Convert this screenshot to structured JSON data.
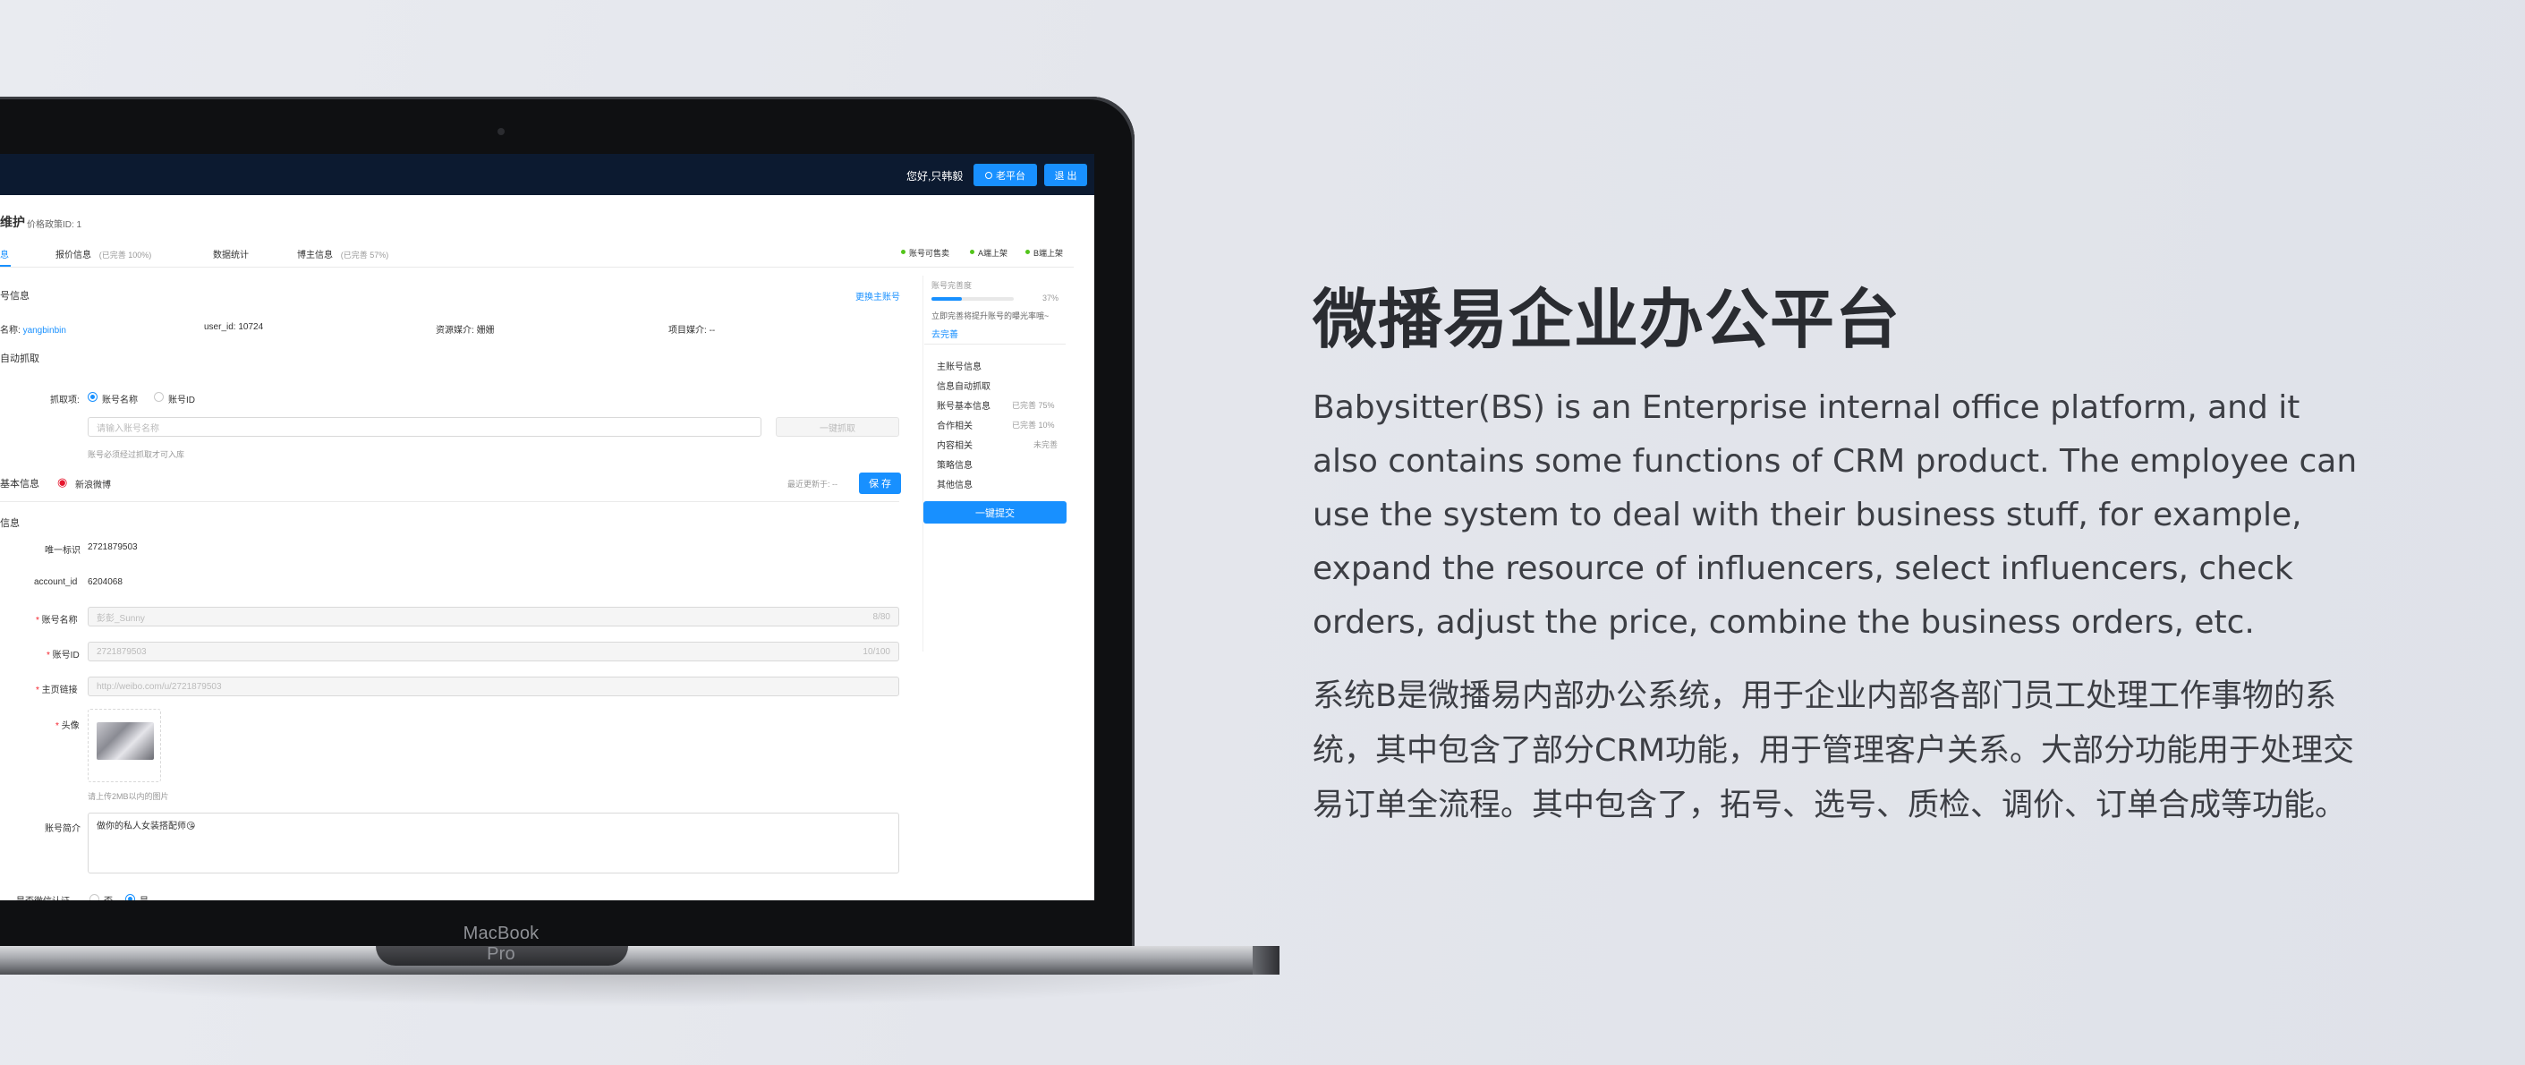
{
  "laptop": {
    "brand": "MacBook Pro"
  },
  "app": {
    "greeting": "您好,只韩毅",
    "old_platform_label": "老平台",
    "logout_label": "退 出",
    "page_title": "维护",
    "price_policy": "价格政策ID: 1",
    "tabs": [
      {
        "label": "息",
        "note": ""
      },
      {
        "label": "报价信息",
        "note": "(已完善 100%)"
      },
      {
        "label": "数据统计",
        "note": ""
      },
      {
        "label": "博主信息",
        "note": "(已完善 57%)"
      }
    ],
    "status_tags": [
      "账号可售卖",
      "A端上架",
      "B端上架"
    ],
    "section_main_account": "号信息",
    "change_main_account": "更换主账号",
    "info_row": {
      "name_label": "名称:",
      "name_value": "yangbinbin",
      "user_id_label": "user_id:",
      "user_id_value": "10724",
      "media_label": "资源媒介:",
      "media_value": "姗姗",
      "project_media_label": "项目媒介:",
      "project_media_value": "--"
    },
    "auto_fetch_title": "自动抓取",
    "fetch_item_label": "抓取项:",
    "fetch_options": [
      "账号名称",
      "账号ID"
    ],
    "fetch_input_placeholder": "请输入账号名称",
    "one_click_fetch": "一键抓取",
    "fetch_hint": "账号必须经过抓取才可入库",
    "basic_info_title": "基本信息",
    "platform": "新浪微博",
    "last_update": "最近更新于: --",
    "save_label": "保 存",
    "info_subtitle": "信息",
    "fields": {
      "unique_id_label": "唯一标识",
      "unique_id_value": "2721879503",
      "account_id_label": "account_id",
      "account_id_value": "6204068",
      "account_name_label": "账号名称",
      "account_name_value": "彭彭_Sunny",
      "account_name_count": "8/80",
      "account_no_label": "账号ID",
      "account_no_value": "2721879503",
      "account_no_count": "10/100",
      "homepage_label": "主页链接",
      "homepage_value": "http://weibo.com/u/2721879503",
      "avatar_label": "头像",
      "avatar_hint": "请上传2MB以内的图片",
      "intro_label": "账号简介",
      "intro_value": "做你的私人女装搭配师😘",
      "verified_label": "是否微信认证",
      "verified_options": [
        "否",
        "是"
      ]
    },
    "side_panel": {
      "completeness_label": "账号完善度",
      "completeness_value": "37%",
      "completeness_fraction": 0.37,
      "tip": "立即完善将提升账号的曝光率哦~",
      "tip_link": "去完善",
      "items": [
        {
          "label": "主账号信息",
          "status": ""
        },
        {
          "label": "信息自动抓取",
          "status": ""
        },
        {
          "label": "账号基本信息",
          "status": "已完善 75%"
        },
        {
          "label": "合作相关",
          "status": "已完善 10%"
        },
        {
          "label": "内容相关",
          "status": "未完善"
        },
        {
          "label": "策略信息",
          "status": ""
        },
        {
          "label": "其他信息",
          "status": ""
        }
      ],
      "submit_label": "一键提交"
    }
  },
  "hero": {
    "headline": "微播易企业办公平台",
    "paragraph_en": "Babysitter(BS) is an Enterprise internal office platform, and it also contains some functions of CRM product. The employee can use the system to deal with their business stuff, for example, expand the resource of influencers, select influencers, check orders, adjust the price, combine the business orders, etc.",
    "paragraph_cn": "系统B是微播易内部办公系统，用于企业内部各部门员工处理工作事物的系统，其中包含了部分CRM功能，用于管理客户关系。大部分功能用于处理交易订单全流程。其中包含了，拓号、选号、质检、调价、订单合成等功能。"
  }
}
